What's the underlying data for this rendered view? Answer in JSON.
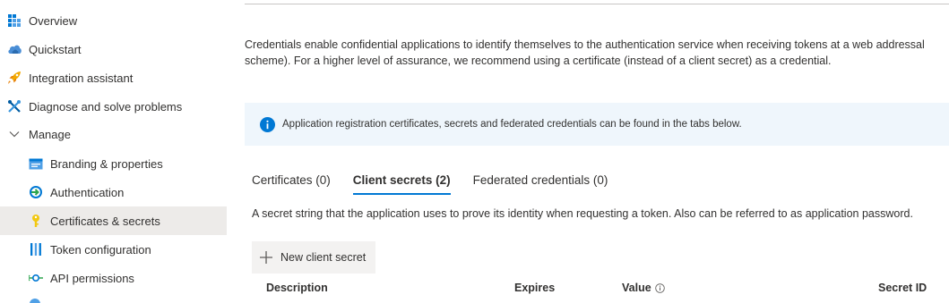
{
  "sidebar": {
    "items": [
      {
        "label": "Overview",
        "icon": "grid-icon",
        "level": "top"
      },
      {
        "label": "Quickstart",
        "icon": "cloud-icon",
        "level": "top"
      },
      {
        "label": "Integration assistant",
        "icon": "rocket-icon",
        "level": "top"
      },
      {
        "label": "Diagnose and solve problems",
        "icon": "wrench-icon",
        "level": "top"
      },
      {
        "label": "Manage",
        "icon": "chevron-down-icon",
        "level": "top"
      },
      {
        "label": "Branding & properties",
        "icon": "branding-icon",
        "level": "sub"
      },
      {
        "label": "Authentication",
        "icon": "authentication-icon",
        "level": "sub"
      },
      {
        "label": "Certificates & secrets",
        "icon": "key-icon",
        "level": "sub",
        "active": true
      },
      {
        "label": "Token configuration",
        "icon": "token-bars-icon",
        "level": "sub"
      },
      {
        "label": "API permissions",
        "icon": "api-permissions-icon",
        "level": "sub"
      }
    ]
  },
  "main": {
    "intro_line1": "Credentials enable confidential applications to identify themselves to the authentication service when receiving tokens at a web addressal",
    "intro_line2": "scheme). For a higher level of assurance, we recommend using a certificate (instead of a client secret) as a credential.",
    "info_bar": "Application registration certificates, secrets and federated credentials can be found in the tabs below.",
    "tabs": [
      {
        "label": "Certificates (0)",
        "selected": false
      },
      {
        "label": "Client secrets (2)",
        "selected": true
      },
      {
        "label": "Federated credentials (0)",
        "selected": false
      }
    ],
    "tab_description": "A secret string that the application uses to prove its identity when requesting a token. Also can be referred to as application password.",
    "new_secret_label": "New client secret",
    "columns": {
      "description": "Description",
      "expires": "Expires",
      "value": "Value",
      "secret_id": "Secret ID"
    }
  },
  "colors": {
    "accent": "#0078d4",
    "active_bg": "#edebe9",
    "info_bg": "#eff6fc",
    "button_bg": "#f3f2f1"
  }
}
